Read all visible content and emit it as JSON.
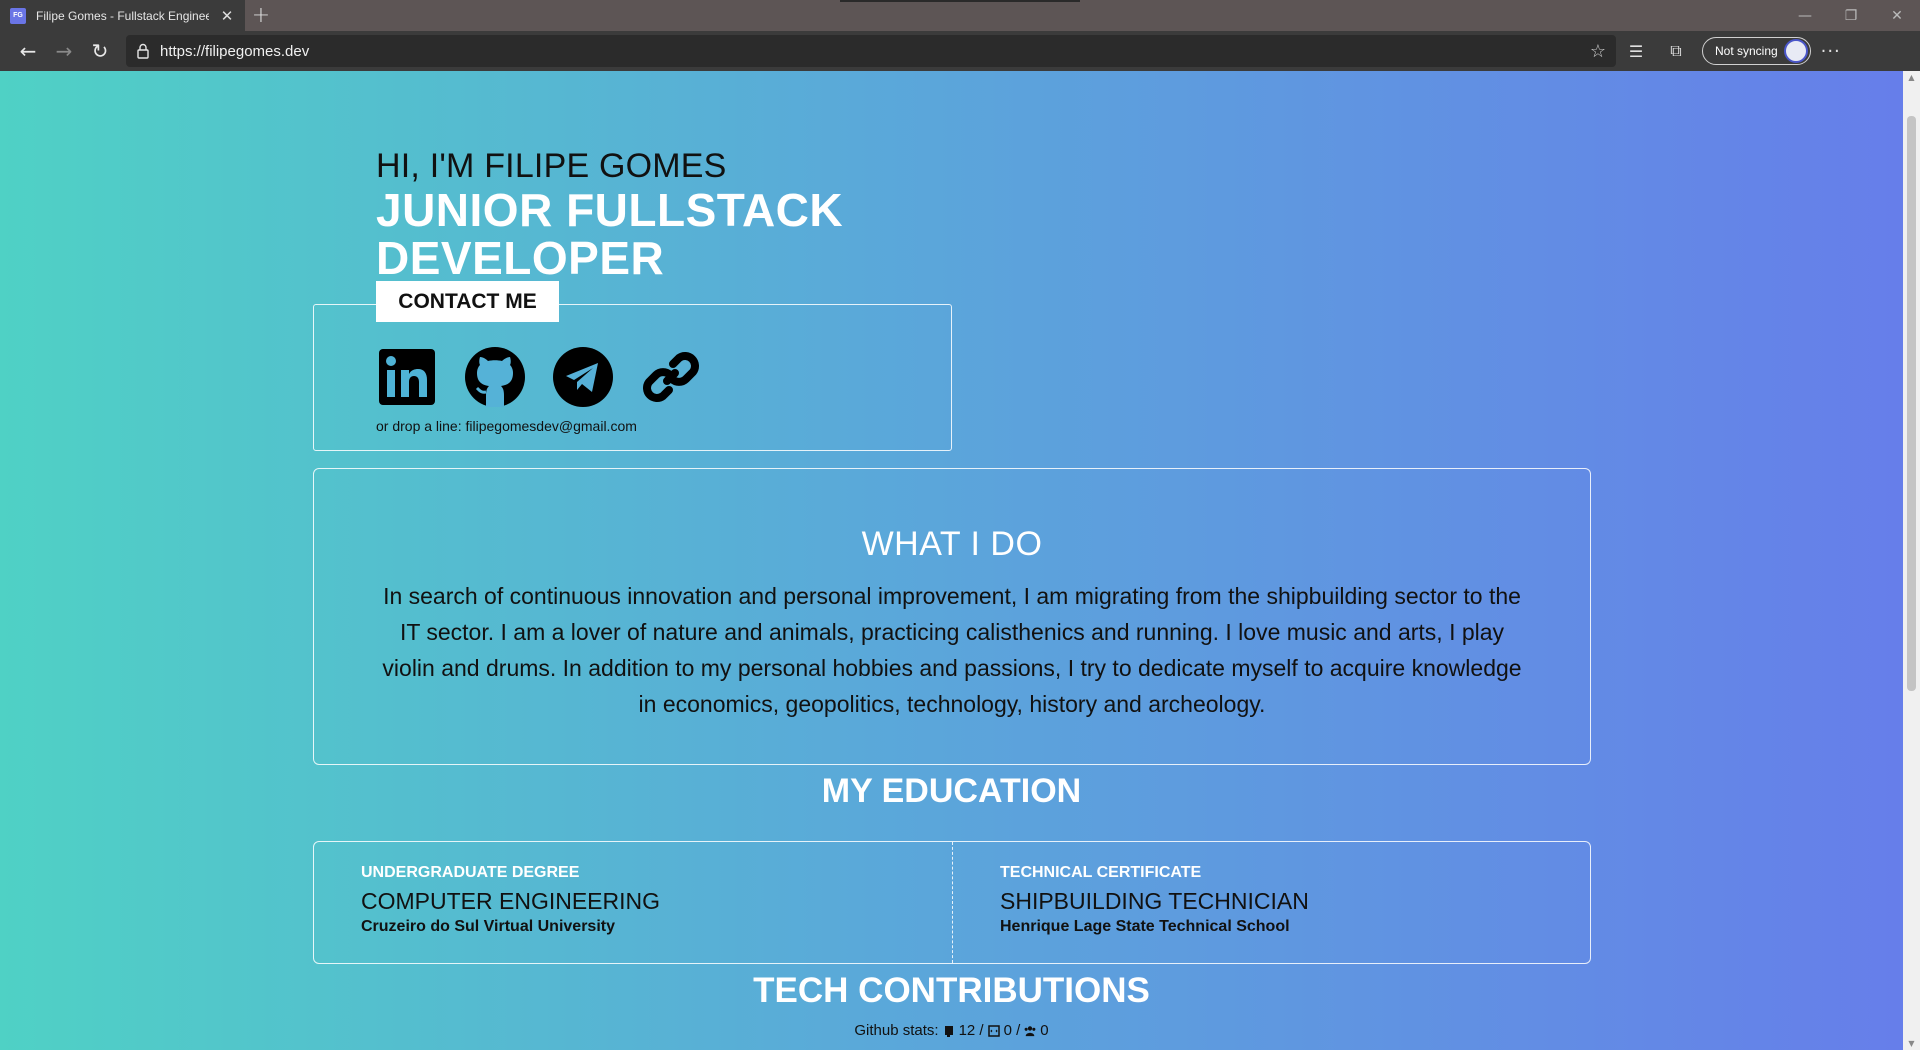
{
  "browser": {
    "tab_title": "Filipe Gomes - Fullstack Enginee",
    "favicon_text": "FG",
    "url": "https://filipegomes.dev",
    "sync_label": "Not syncing"
  },
  "hero": {
    "greeting": "HI, I'M FILIPE GOMES",
    "role_line1": "JUNIOR FULLSTACK",
    "role_line2": "DEVELOPER"
  },
  "contact": {
    "button_label": "CONTACT ME",
    "socials": [
      "linkedin-icon",
      "github-icon",
      "telegram-icon",
      "link-icon"
    ],
    "mail_line": "or drop a line: filipegomesdev@gmail.com"
  },
  "what_i_do": {
    "title": "WHAT I DO",
    "text": "In search of continuous innovation and personal improvement, I am migrating from the shipbuilding sector to the IT sector. I am a lover of nature and animals, practicing calisthenics and running. I love music and arts, I play violin and drums. In addition to my personal hobbies and passions, I try to dedicate myself to acquire knowledge in economics, geopolitics, technology, history and archeology."
  },
  "education": {
    "title": "MY EDUCATION",
    "items": [
      {
        "type": "UNDERGRADUATE DEGREE",
        "name": "COMPUTER ENGINEERING",
        "school": "Cruzeiro do Sul Virtual University"
      },
      {
        "type": "TECHNICAL CERTIFICATE",
        "name": "SHIPBUILDING TECHNICIAN",
        "school": "Henrique Lage State Technical School"
      }
    ]
  },
  "tech": {
    "title": "TECH CONTRIBUTIONS",
    "stats_label": "Github stats:",
    "repos": "12 /",
    "gists": "0 /",
    "followers": "0"
  },
  "colors": {
    "gradient_start": "#4fd1c5",
    "gradient_end": "#667eea"
  }
}
